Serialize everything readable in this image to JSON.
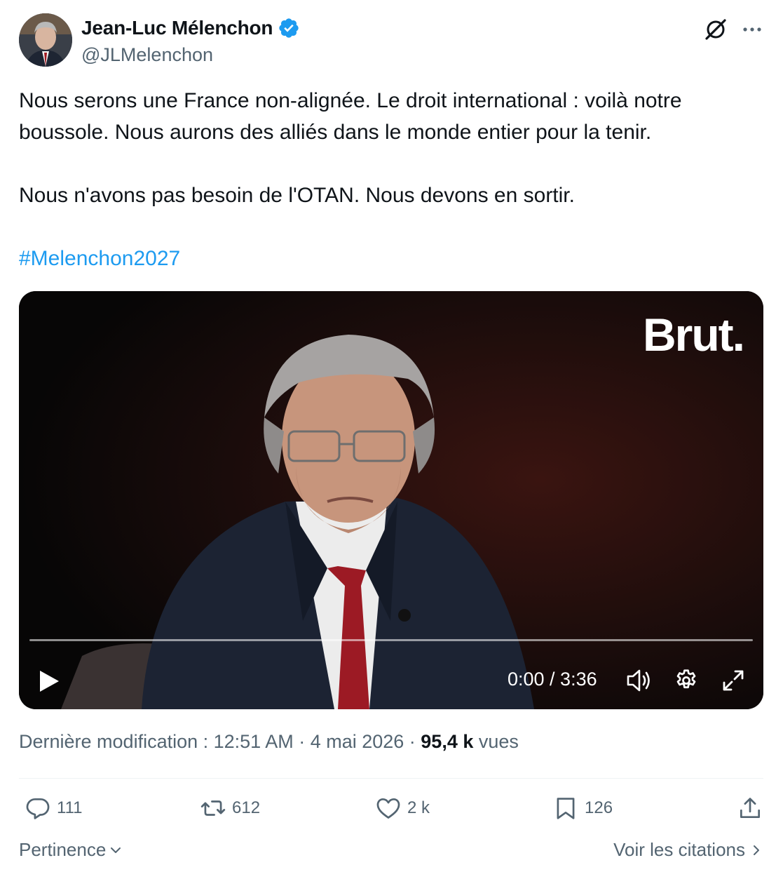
{
  "author": {
    "name": "Jean-Luc Mélenchon",
    "handle": "@JLMelenchon",
    "verified_color": "#1d9bf0"
  },
  "tweet": {
    "paragraph1_line1": "Nous serons une France non-alignée. Le droit international : voilà notre",
    "paragraph1_line2": "boussole. Nous aurons des alliés dans le monde entier pour la tenir.",
    "paragraph2": "Nous n'avons pas besoin de l'OTAN. Nous devons en sortir.",
    "hashtag": "#Melenchon2027"
  },
  "video": {
    "watermark": "Brut.",
    "time": "0:00 / 3:36",
    "progress": 0
  },
  "meta": {
    "edited_label": "Dernière modification : 12:51 AM · 4 mai 2026 · ",
    "views_count": "95,4 k",
    "views_label": " vues"
  },
  "actions": {
    "replies": "111",
    "reposts": "612",
    "likes": "2 k",
    "bookmarks": "126"
  },
  "footer": {
    "sort_label": "Pertinence",
    "quotes_label": "Voir les citations"
  },
  "icons": {
    "verified": "verified-badge-icon",
    "grok": "grok-icon",
    "more": "more-icon",
    "play": "play-icon",
    "volume": "volume-icon",
    "settings": "gear-icon",
    "fullscreen": "fullscreen-icon",
    "reply": "reply-icon",
    "repost": "repost-icon",
    "like": "heart-icon",
    "bookmark": "bookmark-icon",
    "share": "share-icon"
  }
}
